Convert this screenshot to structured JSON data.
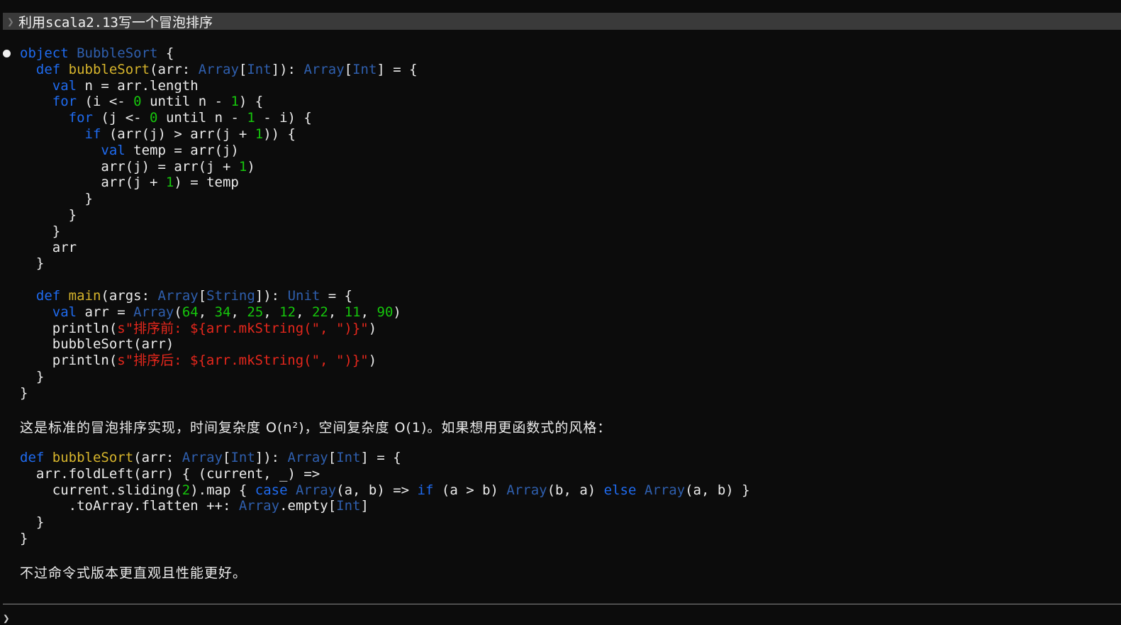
{
  "prompt": {
    "text": "利用scala2.13写一个冒泡排序"
  },
  "code_blocks": [
    {
      "lines": [
        [
          {
            "t": "kw",
            "s": "object "
          },
          {
            "t": "ty",
            "s": "BubbleSort"
          },
          {
            "t": "pl",
            "s": " {"
          }
        ],
        [
          {
            "t": "pl",
            "s": "  "
          },
          {
            "t": "kw",
            "s": "def "
          },
          {
            "t": "fn",
            "s": "bubbleSort"
          },
          {
            "t": "pl",
            "s": "(arr: "
          },
          {
            "t": "ty",
            "s": "Array"
          },
          {
            "t": "pl",
            "s": "["
          },
          {
            "t": "ty",
            "s": "Int"
          },
          {
            "t": "pl",
            "s": "]): "
          },
          {
            "t": "ty",
            "s": "Array"
          },
          {
            "t": "pl",
            "s": "["
          },
          {
            "t": "ty",
            "s": "Int"
          },
          {
            "t": "pl",
            "s": "] = {"
          }
        ],
        [
          {
            "t": "pl",
            "s": "    "
          },
          {
            "t": "kw",
            "s": "val"
          },
          {
            "t": "pl",
            "s": " n = arr.length"
          }
        ],
        [
          {
            "t": "pl",
            "s": "    "
          },
          {
            "t": "kw",
            "s": "for"
          },
          {
            "t": "pl",
            "s": " (i <- "
          },
          {
            "t": "nu",
            "s": "0"
          },
          {
            "t": "pl",
            "s": " until n - "
          },
          {
            "t": "nu",
            "s": "1"
          },
          {
            "t": "pl",
            "s": ") {"
          }
        ],
        [
          {
            "t": "pl",
            "s": "      "
          },
          {
            "t": "kw",
            "s": "for"
          },
          {
            "t": "pl",
            "s": " (j <- "
          },
          {
            "t": "nu",
            "s": "0"
          },
          {
            "t": "pl",
            "s": " until n - "
          },
          {
            "t": "nu",
            "s": "1"
          },
          {
            "t": "pl",
            "s": " - i) {"
          }
        ],
        [
          {
            "t": "pl",
            "s": "        "
          },
          {
            "t": "kw",
            "s": "if"
          },
          {
            "t": "pl",
            "s": " (arr(j) > arr(j + "
          },
          {
            "t": "nu",
            "s": "1"
          },
          {
            "t": "pl",
            "s": ")) {"
          }
        ],
        [
          {
            "t": "pl",
            "s": "          "
          },
          {
            "t": "kw",
            "s": "val"
          },
          {
            "t": "pl",
            "s": " temp = arr(j)"
          }
        ],
        [
          {
            "t": "pl",
            "s": "          arr(j) = arr(j + "
          },
          {
            "t": "nu",
            "s": "1"
          },
          {
            "t": "pl",
            "s": ")"
          }
        ],
        [
          {
            "t": "pl",
            "s": "          arr(j + "
          },
          {
            "t": "nu",
            "s": "1"
          },
          {
            "t": "pl",
            "s": ") = temp"
          }
        ],
        [
          {
            "t": "pl",
            "s": "        }"
          }
        ],
        [
          {
            "t": "pl",
            "s": "      }"
          }
        ],
        [
          {
            "t": "pl",
            "s": "    }"
          }
        ],
        [
          {
            "t": "pl",
            "s": "    arr"
          }
        ],
        [
          {
            "t": "pl",
            "s": "  }"
          }
        ],
        [
          {
            "t": "pl",
            "s": ""
          }
        ],
        [
          {
            "t": "pl",
            "s": "  "
          },
          {
            "t": "kw",
            "s": "def "
          },
          {
            "t": "fn",
            "s": "main"
          },
          {
            "t": "pl",
            "s": "(args: "
          },
          {
            "t": "ty",
            "s": "Array"
          },
          {
            "t": "pl",
            "s": "["
          },
          {
            "t": "ty",
            "s": "String"
          },
          {
            "t": "pl",
            "s": "]): "
          },
          {
            "t": "ty",
            "s": "Unit"
          },
          {
            "t": "pl",
            "s": " = {"
          }
        ],
        [
          {
            "t": "pl",
            "s": "    "
          },
          {
            "t": "kw",
            "s": "val"
          },
          {
            "t": "pl",
            "s": " arr = "
          },
          {
            "t": "ty",
            "s": "Array"
          },
          {
            "t": "pl",
            "s": "("
          },
          {
            "t": "nu",
            "s": "64"
          },
          {
            "t": "pl",
            "s": ", "
          },
          {
            "t": "nu",
            "s": "34"
          },
          {
            "t": "pl",
            "s": ", "
          },
          {
            "t": "nu",
            "s": "25"
          },
          {
            "t": "pl",
            "s": ", "
          },
          {
            "t": "nu",
            "s": "12"
          },
          {
            "t": "pl",
            "s": ", "
          },
          {
            "t": "nu",
            "s": "22"
          },
          {
            "t": "pl",
            "s": ", "
          },
          {
            "t": "nu",
            "s": "11"
          },
          {
            "t": "pl",
            "s": ", "
          },
          {
            "t": "nu",
            "s": "90"
          },
          {
            "t": "pl",
            "s": ")"
          }
        ],
        [
          {
            "t": "pl",
            "s": "    println("
          },
          {
            "t": "st",
            "s": "s\"排序前: ${arr.mkString(\", \")}\""
          },
          {
            "t": "pl",
            "s": ")"
          }
        ],
        [
          {
            "t": "pl",
            "s": "    bubbleSort(arr)"
          }
        ],
        [
          {
            "t": "pl",
            "s": "    println("
          },
          {
            "t": "st",
            "s": "s\"排序后: ${arr.mkString(\", \")}\""
          },
          {
            "t": "pl",
            "s": ")"
          }
        ],
        [
          {
            "t": "pl",
            "s": "  }"
          }
        ],
        [
          {
            "t": "pl",
            "s": "}"
          }
        ]
      ]
    },
    {
      "lines": [
        [
          {
            "t": "kw",
            "s": "def "
          },
          {
            "t": "fn",
            "s": "bubbleSort"
          },
          {
            "t": "pl",
            "s": "(arr: "
          },
          {
            "t": "ty",
            "s": "Array"
          },
          {
            "t": "pl",
            "s": "["
          },
          {
            "t": "ty",
            "s": "Int"
          },
          {
            "t": "pl",
            "s": "]): "
          },
          {
            "t": "ty",
            "s": "Array"
          },
          {
            "t": "pl",
            "s": "["
          },
          {
            "t": "ty",
            "s": "Int"
          },
          {
            "t": "pl",
            "s": "] = {"
          }
        ],
        [
          {
            "t": "pl",
            "s": "  arr.foldLeft(arr) { (current, _) =>"
          }
        ],
        [
          {
            "t": "pl",
            "s": "    current.sliding("
          },
          {
            "t": "nu",
            "s": "2"
          },
          {
            "t": "pl",
            "s": ").map { "
          },
          {
            "t": "kw",
            "s": "case "
          },
          {
            "t": "ty",
            "s": "Array"
          },
          {
            "t": "pl",
            "s": "(a, b) => "
          },
          {
            "t": "kw",
            "s": "if"
          },
          {
            "t": "pl",
            "s": " (a > b) "
          },
          {
            "t": "ty",
            "s": "Array"
          },
          {
            "t": "pl",
            "s": "(b, a) "
          },
          {
            "t": "kw",
            "s": "else "
          },
          {
            "t": "ty",
            "s": "Array"
          },
          {
            "t": "pl",
            "s": "(a, b) }"
          }
        ],
        [
          {
            "t": "pl",
            "s": "      .toArray.flatten ++: "
          },
          {
            "t": "ty",
            "s": "Array"
          },
          {
            "t": "pl",
            "s": ".empty["
          },
          {
            "t": "ty",
            "s": "Int"
          },
          {
            "t": "pl",
            "s": "]"
          }
        ],
        [
          {
            "t": "pl",
            "s": "  }"
          }
        ],
        [
          {
            "t": "pl",
            "s": "}"
          }
        ]
      ]
    }
  ],
  "paragraphs": {
    "p1": "这是标准的冒泡排序实现，时间复杂度 O(n²)，空间复杂度 O(1)。如果想用更函数式的风格：",
    "p2": "不过命令式版本更直观且性能更好。"
  },
  "icons": {
    "prompt": "chevron-right-icon",
    "response": "bullet-icon",
    "input": "chevron-right-icon"
  }
}
